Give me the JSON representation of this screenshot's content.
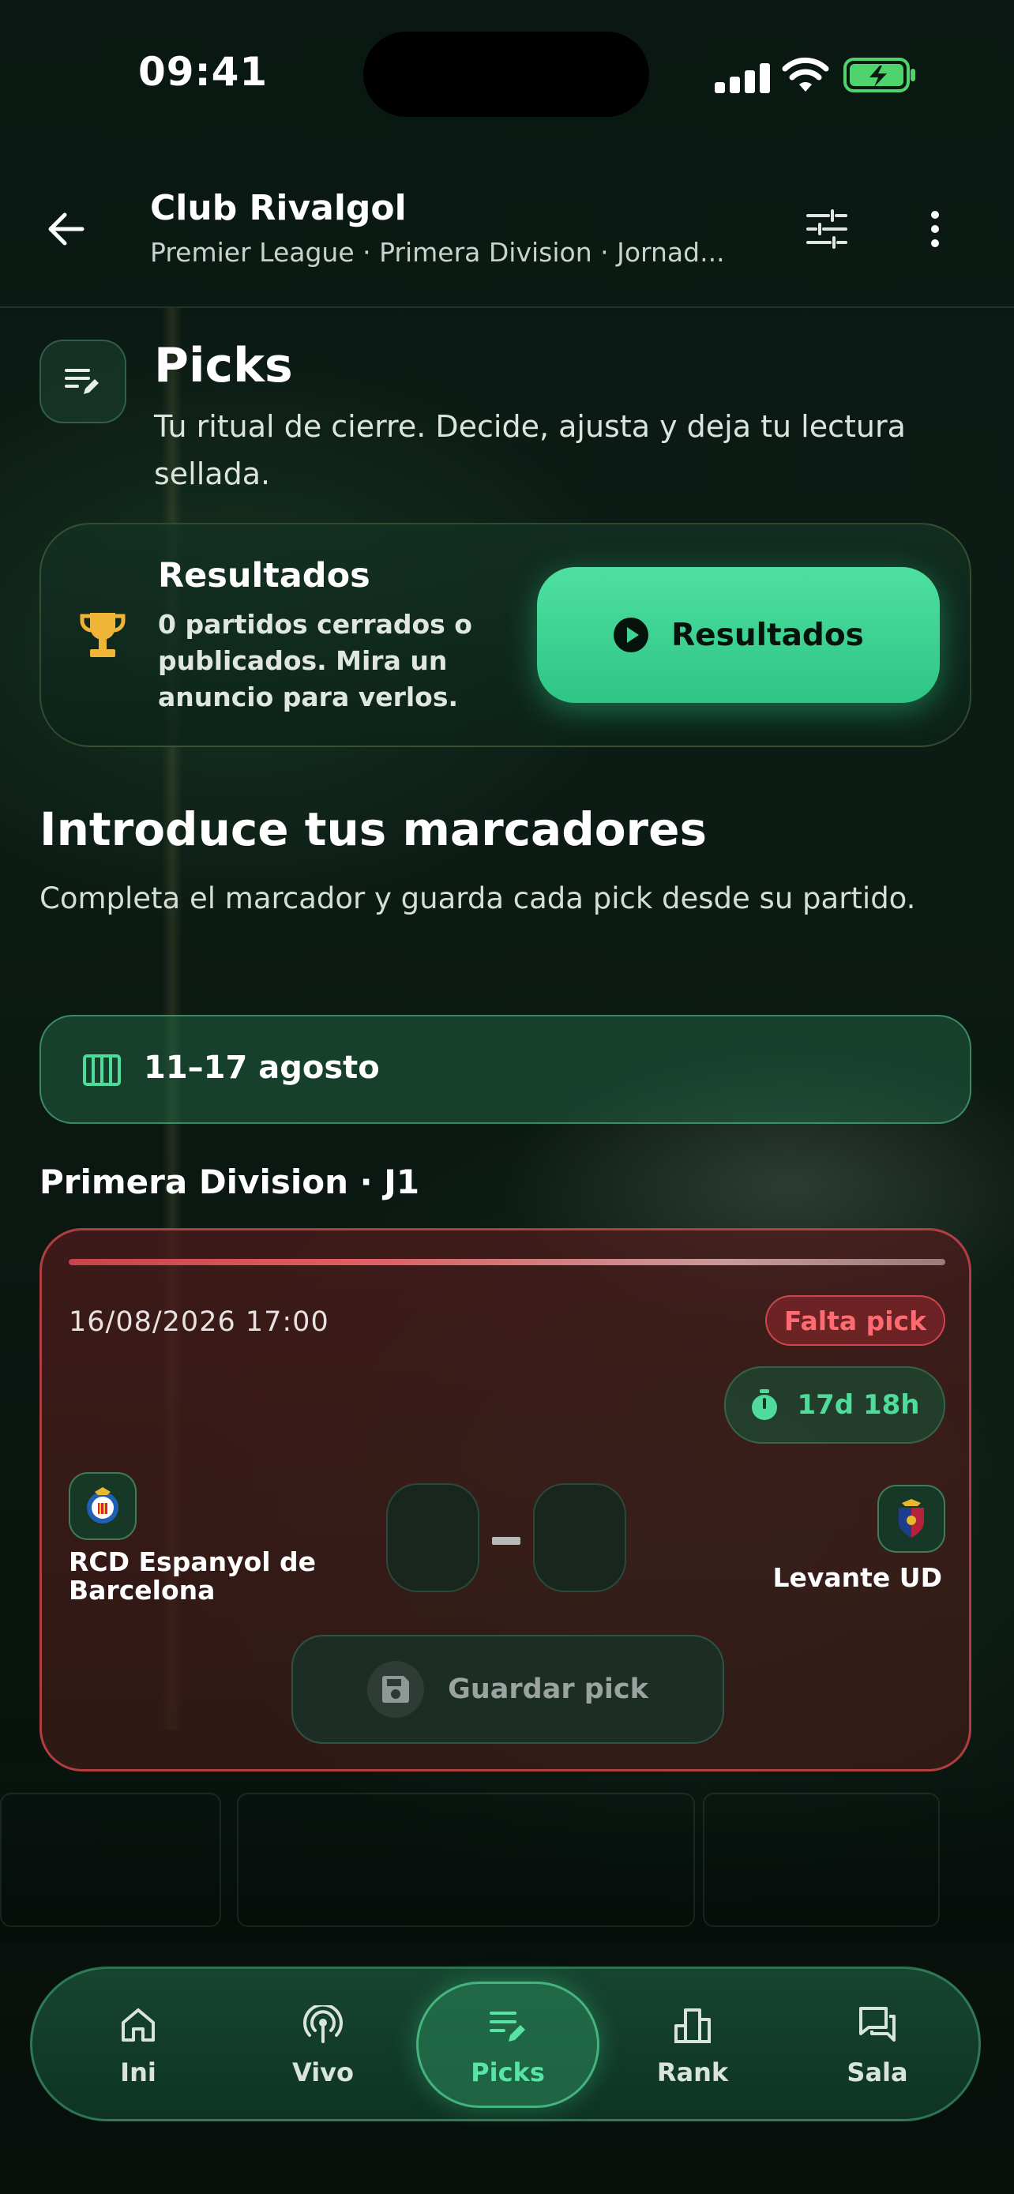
{
  "status_bar": {
    "time": "09:41"
  },
  "header": {
    "title": "Club Rivalgol",
    "subtitle": "Premier League · Primera Division · Jornad..."
  },
  "picks": {
    "title": "Picks",
    "description": "Tu ritual de cierre. Decide, ajusta y deja tu lectura sellada."
  },
  "results_card": {
    "title": "Resultados",
    "description": "0 partidos cerrados o publicados. Mira un anuncio para verlos.",
    "button_label": "Resultados"
  },
  "scores_section": {
    "title": "Introduce tus marcadores",
    "description": "Completa el marcador y guarda cada pick desde su partido."
  },
  "week": {
    "label": "11–17 agosto"
  },
  "league": {
    "label": "Primera Division · J1"
  },
  "match": {
    "datetime": "16/08/2026 17:00",
    "status_badge": "Falta pick",
    "countdown": "17d 18h",
    "home_team": "RCD Espanyol de Barcelona",
    "away_team": "Levante UD",
    "home_score": "",
    "away_score": "",
    "save_label": "Guardar pick"
  },
  "nav": {
    "items": [
      {
        "label": "Ini",
        "icon": "home-icon"
      },
      {
        "label": "Vivo",
        "icon": "live-icon"
      },
      {
        "label": "Picks",
        "icon": "picks-icon",
        "active": true
      },
      {
        "label": "Rank",
        "icon": "rank-icon"
      },
      {
        "label": "Sala",
        "icon": "chat-icon"
      }
    ]
  },
  "colors": {
    "accent_green": "#2ec586",
    "danger_red": "#e05a60",
    "background": "#0b1812"
  }
}
